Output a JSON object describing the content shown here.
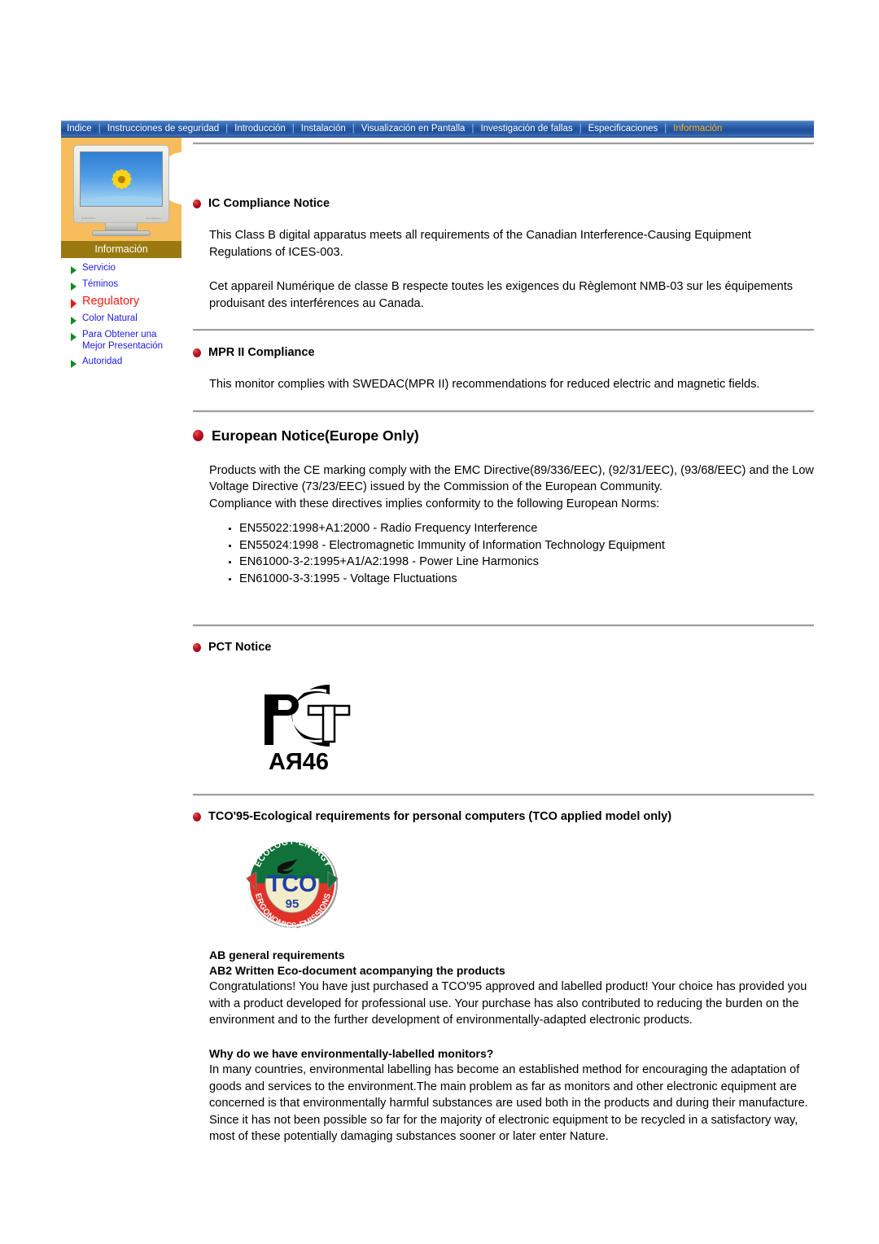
{
  "nav": {
    "items": [
      {
        "label": "Indice",
        "active": false
      },
      {
        "label": "Instrucciones de seguridad",
        "active": false
      },
      {
        "label": "Introducción",
        "active": false
      },
      {
        "label": "Instalación",
        "active": false
      },
      {
        "label": "Visualización en Pantalla",
        "active": false
      },
      {
        "label": "Investigación de fallas",
        "active": false
      },
      {
        "label": "Especificaciones",
        "active": false
      },
      {
        "label": "Información",
        "active": true
      }
    ]
  },
  "sidebar": {
    "thumbnail_alt": "monitor-sunflower-thumbnail",
    "caption": "Información",
    "items": [
      {
        "label": "Servicio",
        "current": false
      },
      {
        "label": "Téminos",
        "current": false
      },
      {
        "label": "Regulatory",
        "current": true
      },
      {
        "label": "Color Natural",
        "current": false
      },
      {
        "label": "Para Obtener una Mejor Presentación",
        "current": false
      },
      {
        "label": "Autoridad",
        "current": false
      }
    ]
  },
  "content": {
    "ic": {
      "heading": "IC Compliance Notice",
      "para_en": "This Class B digital apparatus meets all requirements of the Canadian Interference-Causing Equipment Regulations of ICES-003.",
      "para_fr": "Cet appareil Numérique de classe B respecte toutes les exigences du Règlemont NMB-03 sur les équipements produisant des interférences au Canada."
    },
    "mpr": {
      "heading": "MPR II Compliance",
      "para": "This monitor complies with SWEDAC(MPR II) recommendations for reduced electric and magnetic fields."
    },
    "european": {
      "heading": "European Notice(Europe Only)",
      "para1": "Products with the CE marking comply with the EMC Directive(89/336/EEC), (92/31/EEC), (93/68/EEC) and the Low Voltage Directive (73/23/EEC) issued by the Commission of the European Community.",
      "para2": "Compliance with these directives implies conformity to the following European Norms:",
      "norms": [
        "EN55022:1998+A1:2000 - Radio Frequency Interference",
        "EN55024:1998 - Electromagnetic Immunity of Information Technology Equipment",
        "EN61000-3-2:1995+A1/A2:1998 - Power Line Harmonics",
        "EN61000-3-3:1995 - Voltage Fluctuations"
      ]
    },
    "pct": {
      "heading": "PCT Notice",
      "mark_letters": "PCT",
      "mark_code": "АЯ46"
    },
    "tco": {
      "heading": "TCO'95-Ecological requirements for personal computers (TCO applied model only)",
      "logo": {
        "top_arc": "ECOLOGY•ENERGY",
        "bottom_arc": "ERGONOMICS•EMISSIONS",
        "center": "TCO",
        "year": "95"
      },
      "ab_heading": "AB general requirements",
      "ab2_heading": "AB2 Written Eco-document acompanying the products",
      "ab2_para": "Congratulations! You have just purchased a TCO'95 approved and labelled product! Your choice has provided you with a product developed for professional use. Your purchase has also contributed to reducing the burden on the environment and to the further development of environmentally-adapted electronic products.",
      "why_heading": "Why do we have environmentally-labelled monitors?",
      "why_para": "In many countries, environmental labelling has become an established method for encouraging the adaptation of goods and services to the environment.The main problem as far as monitors and other electronic equipment are concerned is that environmentally harmful substances are used both in the products and during their manufacture. Since it has not been possible so far for the majority of electronic equipment to be recycled in a satisfactory way, most of these potentially damaging substances sooner or later enter Nature."
    }
  },
  "colors": {
    "nav_bg": "#1d4f9c",
    "nav_active": "#ffb524",
    "sidebar_panel": "#f7bc5c",
    "sidebar_caption_bg": "#9a7a10",
    "link": "#1a1ae8",
    "link_current": "#f41a12",
    "bullet_green": "#128a28",
    "bullet_red": "#e31c13",
    "heading_ball": "#bf1324",
    "tco_green": "#11713a",
    "tco_red": "#e23127",
    "tco_blue": "#1f3fa8"
  }
}
